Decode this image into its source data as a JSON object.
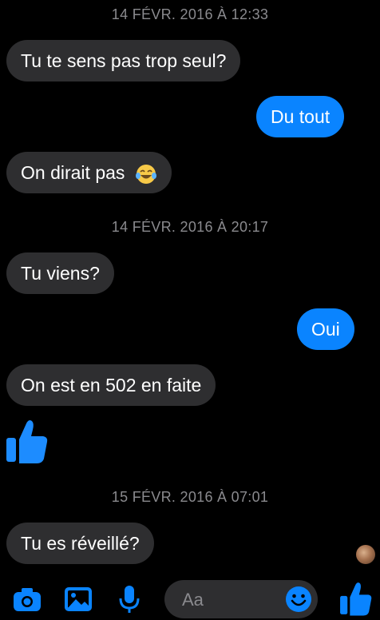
{
  "conversation": {
    "timestamps": [
      "14 FÉVR. 2016 À 12:33",
      "14 FÉVR. 2016 À 20:17",
      "15 FÉVR. 2016 À 07:01"
    ],
    "messages": [
      {
        "side": "received",
        "text": "Tu te sens pas trop seul?"
      },
      {
        "side": "sent",
        "text": "Du tout"
      },
      {
        "side": "received",
        "text": "On dirait pas",
        "emoji": "tears-of-joy-emoji"
      },
      {
        "side": "received",
        "text": "Tu viens?"
      },
      {
        "side": "sent",
        "text": "Oui"
      },
      {
        "side": "received",
        "text": "On est en 502 en faite"
      },
      {
        "side": "sent",
        "sticker": "thumbs-up-icon"
      },
      {
        "side": "received",
        "text": "Tu es  réveillé?"
      }
    ]
  },
  "composer": {
    "placeholder": "Aa"
  },
  "toolbar": {
    "icons": [
      "camera-icon",
      "image-icon",
      "microphone-icon",
      "emoji-icon",
      "thumbs-up-icon"
    ]
  },
  "colors": {
    "accent": "#0a84ff",
    "received_bubble": "#2e2e30",
    "background": "#000000",
    "timestamp": "#8a8a8e"
  }
}
